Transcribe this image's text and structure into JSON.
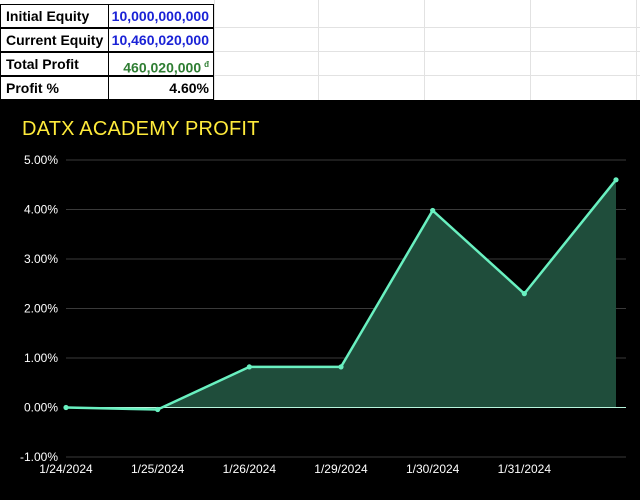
{
  "sheet": {
    "rows": [
      {
        "label": "Initial Equity",
        "value": "10,000,000,000",
        "value_color": "#1a22d6",
        "currency": ""
      },
      {
        "label": "Current Equity",
        "value": "10,460,020,000",
        "value_color": "#1a22d6",
        "currency": ""
      },
      {
        "label": "Total Profit",
        "value": "460,020,000",
        "value_color": "#2e7d32",
        "currency": "đ"
      },
      {
        "label": "Profit %",
        "value": "4.60%",
        "value_color": "#000000",
        "currency": ""
      }
    ]
  },
  "chart_data": {
    "type": "area",
    "title": "DATX ACADEMY PROFIT",
    "xlabel": "",
    "ylabel": "",
    "categories": [
      "1/24/2024",
      "1/25/2024",
      "1/26/2024",
      "1/29/2024",
      "1/30/2024",
      "1/31/2024",
      ""
    ],
    "series": [
      {
        "values": [
          0.0,
          -0.04,
          0.82,
          0.82,
          3.98,
          2.3,
          4.6
        ]
      }
    ],
    "y_ticks": [
      "-1.00%",
      "0.00%",
      "1.00%",
      "2.00%",
      "3.00%",
      "4.00%",
      "5.00%"
    ],
    "ylim": [
      -1,
      5
    ],
    "grid": true,
    "legend": "none",
    "colors": {
      "background": "#000000",
      "line": "#69f0c0",
      "fill": "#1f4d3b",
      "title": "#ffeb3b",
      "axis_text": "#ffffff",
      "grid": "#3a3a3a"
    }
  }
}
